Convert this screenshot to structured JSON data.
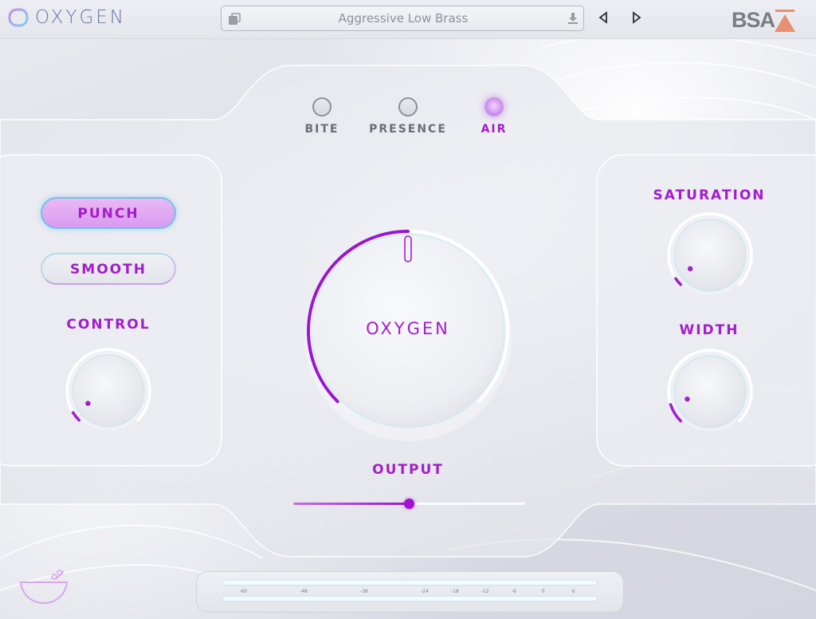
{
  "app": {
    "name": "OXYGEN",
    "brand": "BSA"
  },
  "preset": {
    "name": "Aggressive Low Brass"
  },
  "modes": [
    {
      "label": "BITE",
      "active": false
    },
    {
      "label": "PRESENCE",
      "active": false
    },
    {
      "label": "AIR",
      "active": true
    }
  ],
  "left_panel": {
    "punch_label": "PUNCH",
    "punch_active": true,
    "smooth_label": "SMOOTH",
    "smooth_active": false,
    "control_label": "CONTROL",
    "control_value": 0.05
  },
  "center": {
    "knob_label": "OXYGEN",
    "knob_value": 0.5,
    "output_label": "OUTPUT",
    "output_value": 0.5
  },
  "right_panel": {
    "saturation_label": "SATURATION",
    "saturation_value": 0.04,
    "width_label": "WIDTH",
    "width_value": 0.1
  },
  "meter": {
    "ticks": [
      "-60",
      "-48",
      "-36",
      "-24",
      "-18",
      "-12",
      "-6",
      "0",
      "6"
    ]
  },
  "icons": {
    "preset_menu": "open-window-icon",
    "download": "download-icon",
    "prev": "triangle-left-icon",
    "next": "triangle-right-icon",
    "bottom_left": "bowl-icon"
  },
  "colors": {
    "accent": "#a41ccd",
    "accent_light": "#d99af0",
    "cyan_glow": "#6fc3e8",
    "brand_orange": "#ea8f6f"
  }
}
